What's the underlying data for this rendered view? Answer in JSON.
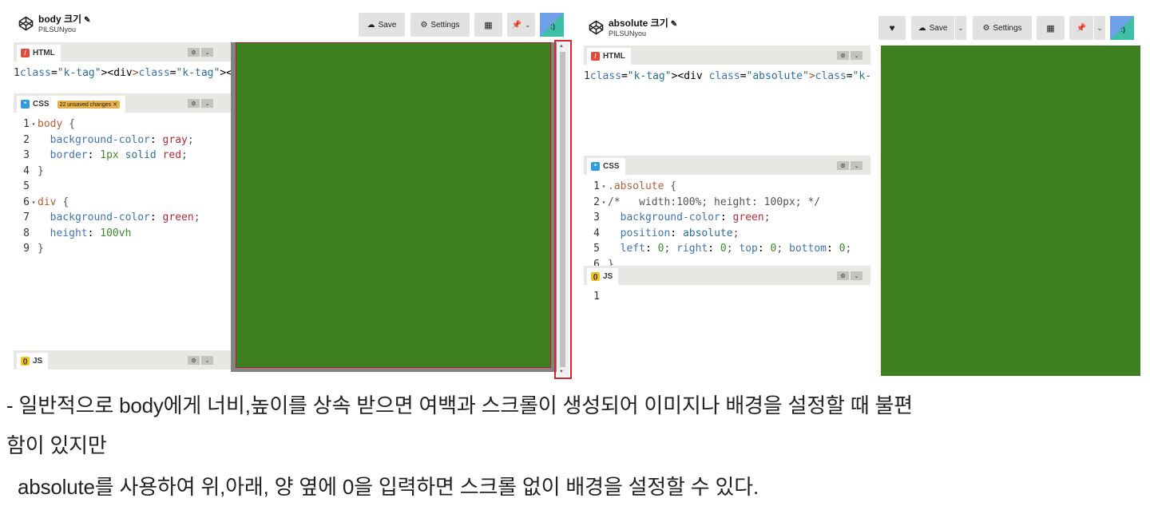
{
  "left": {
    "project_title": "body 크기",
    "author": "PILSUNyou",
    "save_label": "Save",
    "settings_label": "Settings",
    "html_tab": "HTML",
    "css_tab": "CSS",
    "js_tab": "JS",
    "unsaved_badge": "22 unsaved changes ✕",
    "html_code": [
      "<div></div>"
    ],
    "css_code": [
      "body {",
      "  background-color: gray;",
      "  border: 1px solid red;",
      "}",
      "",
      "div {",
      "  background-color: green;",
      "  height: 100vh",
      "}"
    ],
    "js_code": []
  },
  "right": {
    "project_title": "absolute 크기",
    "author": "PILSUNyou",
    "save_label": "Save",
    "settings_label": "Settings",
    "html_tab": "HTML",
    "css_tab": "CSS",
    "js_tab": "JS",
    "html_code": [
      "<div class=\"absolute\"></div>"
    ],
    "css_code": [
      ".absolute {",
      "/*   width:100%; height: 100px; */",
      "  background-color: green;",
      "  position: absolute;",
      "  left: 0; right: 0; top: 0; bottom: 0;",
      "}"
    ],
    "js_code": [
      ""
    ]
  },
  "caption": {
    "line1": "- 일반적으로 body에게 너비,높이를 상속 받으면 여백과 스크롤이 생성되어 이미지나 배경을 설정할 때 불편",
    "line2": "함이 있지만",
    "line3": "  absolute를 사용하여 위,아래, 양 옆에 0을 입력하면 스크롤 없이 배경을 설정할 수 있다."
  },
  "colors": {
    "preview_green": "#3e7f22",
    "body_gray": "#838383",
    "highlight_red": "#d8262b",
    "toolbar_button": "#e2e2e2",
    "panel_header": "#e9e7e3"
  },
  "icons": [
    "codepen-logo-icon",
    "pencil-icon",
    "cloud-icon",
    "gear-icon",
    "layout-grid-icon",
    "pin-icon",
    "chevron-down-icon",
    "heart-icon",
    "avatar-icon"
  ]
}
